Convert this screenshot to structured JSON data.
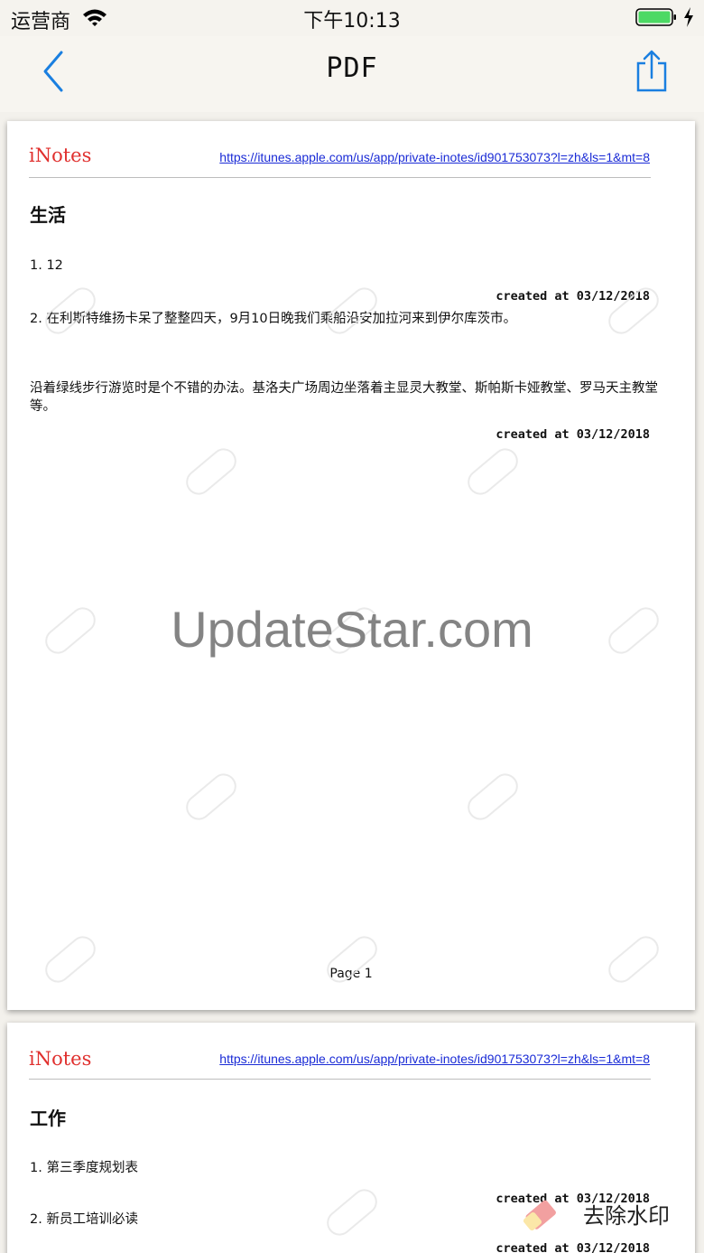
{
  "status_bar": {
    "carrier": "运营商",
    "time": "下午10:13"
  },
  "nav": {
    "title": "PDF"
  },
  "header": {
    "brand": "iNotes",
    "link": "https://itunes.apple.com/us/app/private-inotes/id901753073?l=zh&ls=1&mt=8"
  },
  "pages": [
    {
      "title": "生活",
      "lines": [
        "1. 12",
        "2. 在利斯特维扬卡呆了整整四天，9月10日晚我们乘船沿安加拉河来到伊尔库茨市。",
        "沿着绿线步行游览时是个不错的办法。基洛夫广场周边坐落着主显灵大教堂、斯帕斯卡娅教堂、罗马天主教堂等。"
      ],
      "created": [
        "created at 03/12/2018",
        "created at 03/12/2018"
      ],
      "page_label": "Page 1"
    },
    {
      "title": "工作",
      "lines": [
        "1. 第三季度规划表",
        "2. 新员工培训必读"
      ],
      "created": [
        "created at 03/12/2018",
        "created at 03/12/2018"
      ]
    }
  ],
  "watermark": {
    "text": "UpdateStar.com",
    "remove_label": "去除水印"
  },
  "colors": {
    "accent": "#1a7fe0",
    "brand": "#e0302e",
    "link": "#1a2bd6",
    "battery": "#4cd964"
  }
}
